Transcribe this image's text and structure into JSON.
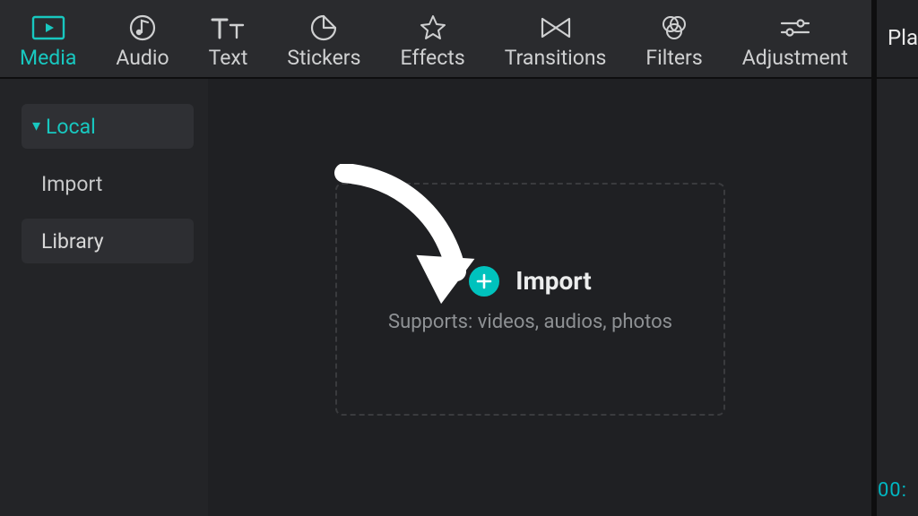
{
  "colors": {
    "accent": "#18c8c0",
    "plusBadge": "#00c2bd"
  },
  "topbar": {
    "tabs": [
      {
        "id": "media",
        "label": "Media",
        "active": true
      },
      {
        "id": "audio",
        "label": "Audio"
      },
      {
        "id": "text",
        "label": "Text"
      },
      {
        "id": "stickers",
        "label": "Stickers"
      },
      {
        "id": "effects",
        "label": "Effects"
      },
      {
        "id": "transitions",
        "label": "Transitions"
      },
      {
        "id": "filters",
        "label": "Filters"
      },
      {
        "id": "adjustment",
        "label": "Adjustment"
      }
    ],
    "rightPanelTab": "Player"
  },
  "sidebar": {
    "items": [
      {
        "id": "local",
        "label": "Local",
        "active": true,
        "expandable": true
      },
      {
        "id": "import",
        "label": "Import"
      },
      {
        "id": "library",
        "label": "Library",
        "activeDark": true
      }
    ]
  },
  "importArea": {
    "button_label": "Import",
    "support_text": "Supports: videos, audios, photos"
  },
  "timecode": "00:",
  "annotation": {
    "arrow": true
  }
}
